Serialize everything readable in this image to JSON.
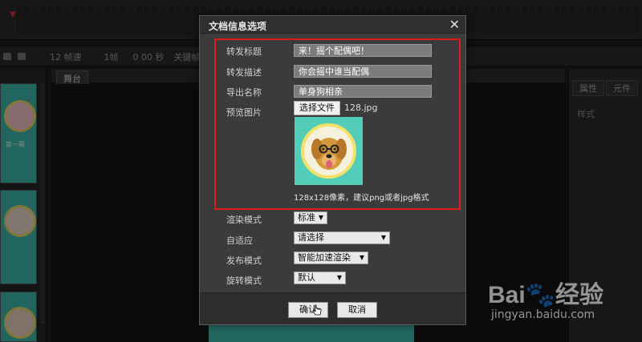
{
  "status_bar": {
    "fps": "12 帧速",
    "frame": "1帧",
    "time": "0 00 秒",
    "keyframe_label": "关键帧名"
  },
  "left_panel": {
    "thumb1_caption": "第一幕"
  },
  "stage": {
    "tab_label": "舞台"
  },
  "right_panel": {
    "tabs": [
      "属性",
      "元件"
    ],
    "style_label": "样式"
  },
  "dialog": {
    "title": "文档信息选项",
    "close_glyph": "✕",
    "fields": [
      {
        "label": "转发标题",
        "value": "来！摇个配偶吧！"
      },
      {
        "label": "转发描述",
        "value": "你会摇中谁当配偶"
      },
      {
        "label": "导出名称",
        "value": "单身狗相亲"
      }
    ],
    "preview_label": "预览图片",
    "choose_file_button": "选择文件",
    "file_name": "128.jpg",
    "hint": "128x128像素，建议png或者jpg格式",
    "selects": [
      {
        "label": "渲染模式",
        "value": "标准"
      },
      {
        "label": "自适应",
        "value": "请选择"
      },
      {
        "label": "发布模式",
        "value": "智能加速渲染"
      },
      {
        "label": "旋转模式",
        "value": "默认"
      }
    ],
    "ok_button": "确认",
    "cancel_button": "取消",
    "highlight_color": "#e01b1b"
  },
  "watermark": {
    "brand": "Bai",
    "brand_cn": "经验",
    "url": "jingyan.baidu.com"
  }
}
